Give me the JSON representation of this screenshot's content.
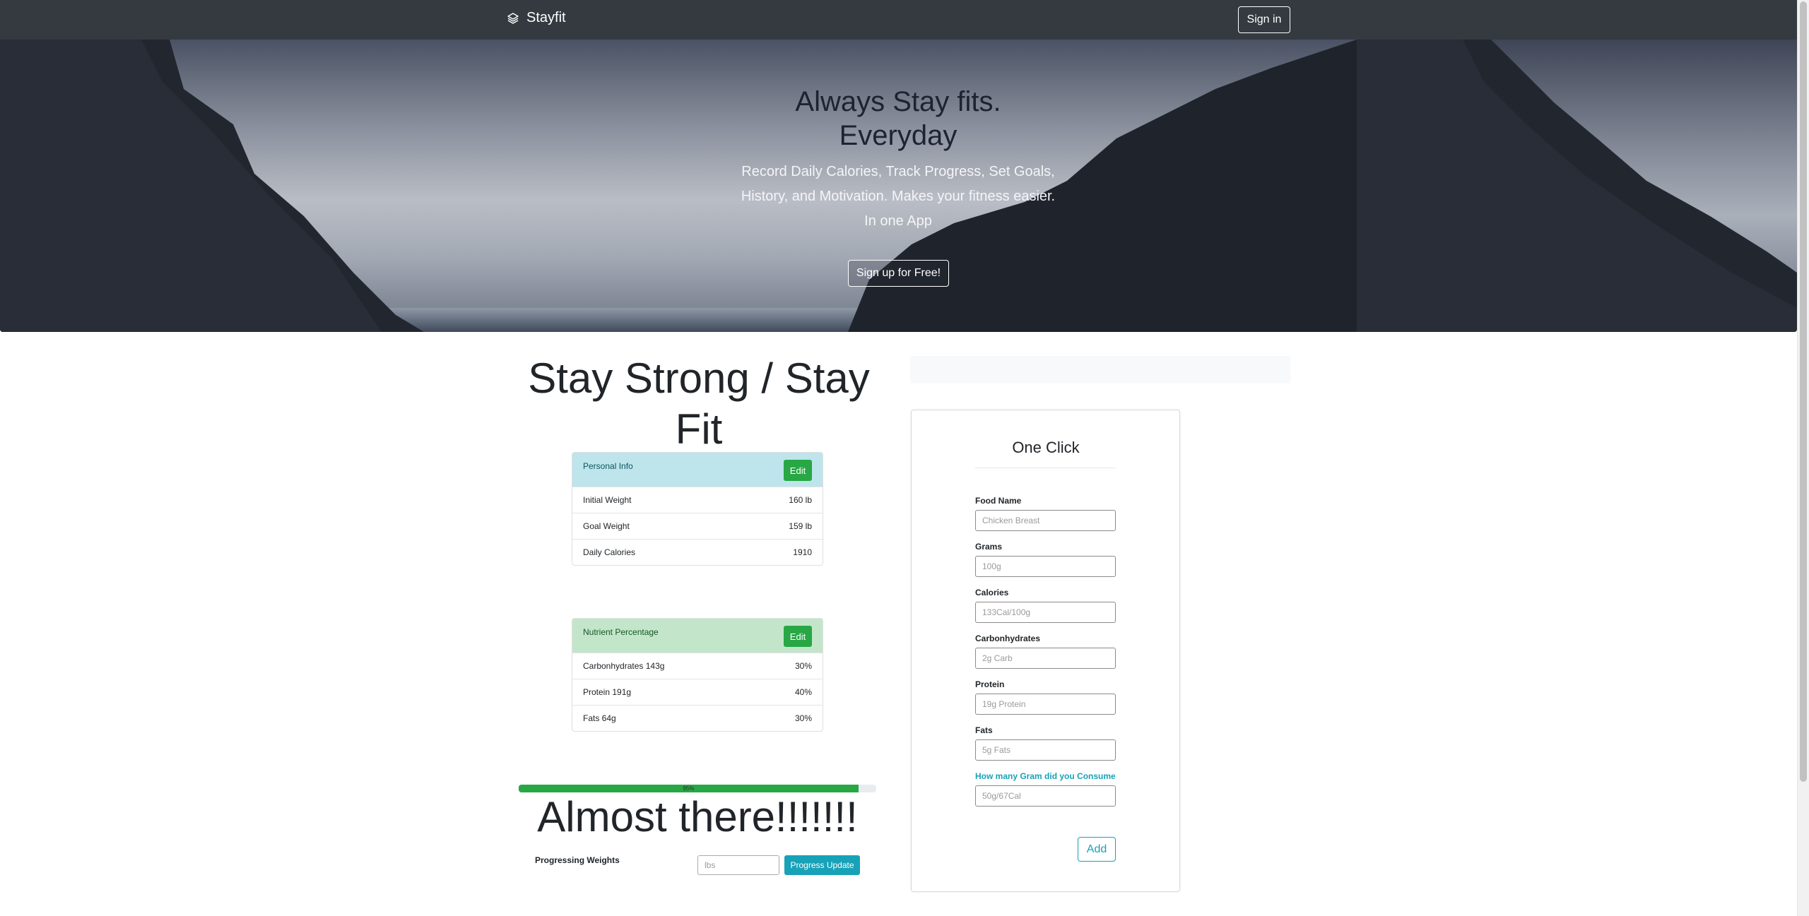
{
  "navbar": {
    "brand": "Stayfit",
    "signin_label": "Sign in"
  },
  "hero": {
    "title_line1": "Always Stay fits.",
    "title_line2": "Everyday",
    "lead_line1": "Record Daily Calories, Track Progress, Set Goals,",
    "lead_line2": "History, and Motivation. Makes your fitness easier.",
    "lead_line3": "In one App",
    "signup_label": "Sign up for Free!"
  },
  "tagline": "Stay Strong / Stay Fit",
  "personal_info": {
    "title": "Personal Info",
    "edit_label": "Edit",
    "rows": [
      {
        "label": "Initial Weight",
        "value": "160 lb"
      },
      {
        "label": "Goal Weight",
        "value": "159 lb"
      },
      {
        "label": "Daily Calories",
        "value": "1910"
      }
    ]
  },
  "nutrient": {
    "title": "Nutrient Percentage",
    "edit_label": "Edit",
    "rows": [
      {
        "label": "Carbonhydrates 143g",
        "value": "30%"
      },
      {
        "label": "Protein 191g",
        "value": "40%"
      },
      {
        "label": "Fats 64g",
        "value": "30%"
      }
    ]
  },
  "progress": {
    "percent": 95,
    "label": "95%"
  },
  "almost_text": "Almost there!!!!!!!",
  "progressing": {
    "label": "Progressing Weights",
    "placeholder": "lbs",
    "button_label": "Progress Update"
  },
  "one_click": {
    "title": "One Click",
    "fields": [
      {
        "label": "Food Name",
        "placeholder": "Chicken Breast"
      },
      {
        "label": "Grams",
        "placeholder": "100g"
      },
      {
        "label": "Calories",
        "placeholder": "133Cal/100g"
      },
      {
        "label": "Carbonhydrates",
        "placeholder": "2g Carb"
      },
      {
        "label": "Protein",
        "placeholder": "19g Protein"
      },
      {
        "label": "Fats",
        "placeholder": "5g Fats"
      },
      {
        "label": "How many Gram did you Consume",
        "placeholder": "50g/67Cal"
      }
    ],
    "add_label": "Add"
  },
  "colors": {
    "navbar": "#343a40",
    "success": "#28a745",
    "info": "#17a2b8",
    "info_light": "#bee5eb",
    "success_light": "#c3e6cb"
  }
}
